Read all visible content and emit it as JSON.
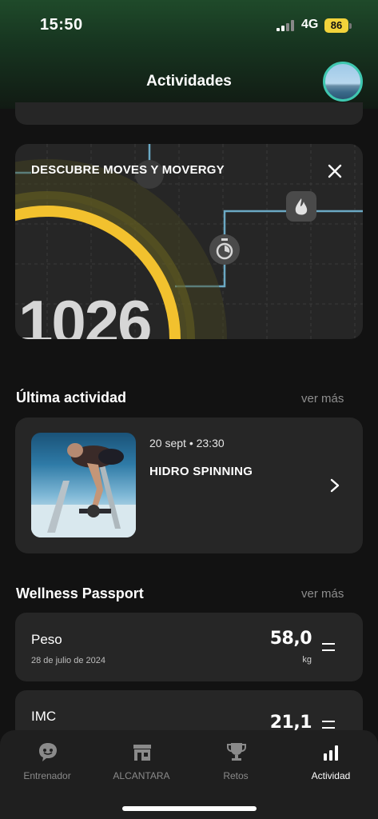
{
  "status_bar": {
    "time": "15:50",
    "network": "4G",
    "battery": "86"
  },
  "header": {
    "title": "Actividades"
  },
  "promo": {
    "title": "DESCUBRE MOVES Y MOVERGY",
    "number": "1026",
    "ring_fill": 0.4,
    "accent_color": "#f2c12e"
  },
  "last_activity": {
    "section_title": "Última actividad",
    "see_more": "ver más",
    "date": "20 sept • 23:30",
    "name": "HIDRO SPINNING"
  },
  "wellness": {
    "section_title": "Wellness Passport",
    "see_more": "ver más",
    "metrics": [
      {
        "label": "Peso",
        "date": "28 de julio de 2024",
        "value": "58,0",
        "unit": "kg",
        "trend_icon": "equal-icon"
      },
      {
        "label": "IMC",
        "value": "21,1",
        "trend_icon": "equal-icon"
      }
    ]
  },
  "tabbar": {
    "tabs": [
      {
        "label": "Entrenador",
        "icon": "chat-face-icon",
        "active": false
      },
      {
        "label": "ALCANTARA",
        "icon": "store-icon",
        "active": false
      },
      {
        "label": "Retos",
        "icon": "trophy-icon",
        "active": false
      },
      {
        "label": "Actividad",
        "icon": "bar-chart-icon",
        "active": true
      }
    ]
  }
}
